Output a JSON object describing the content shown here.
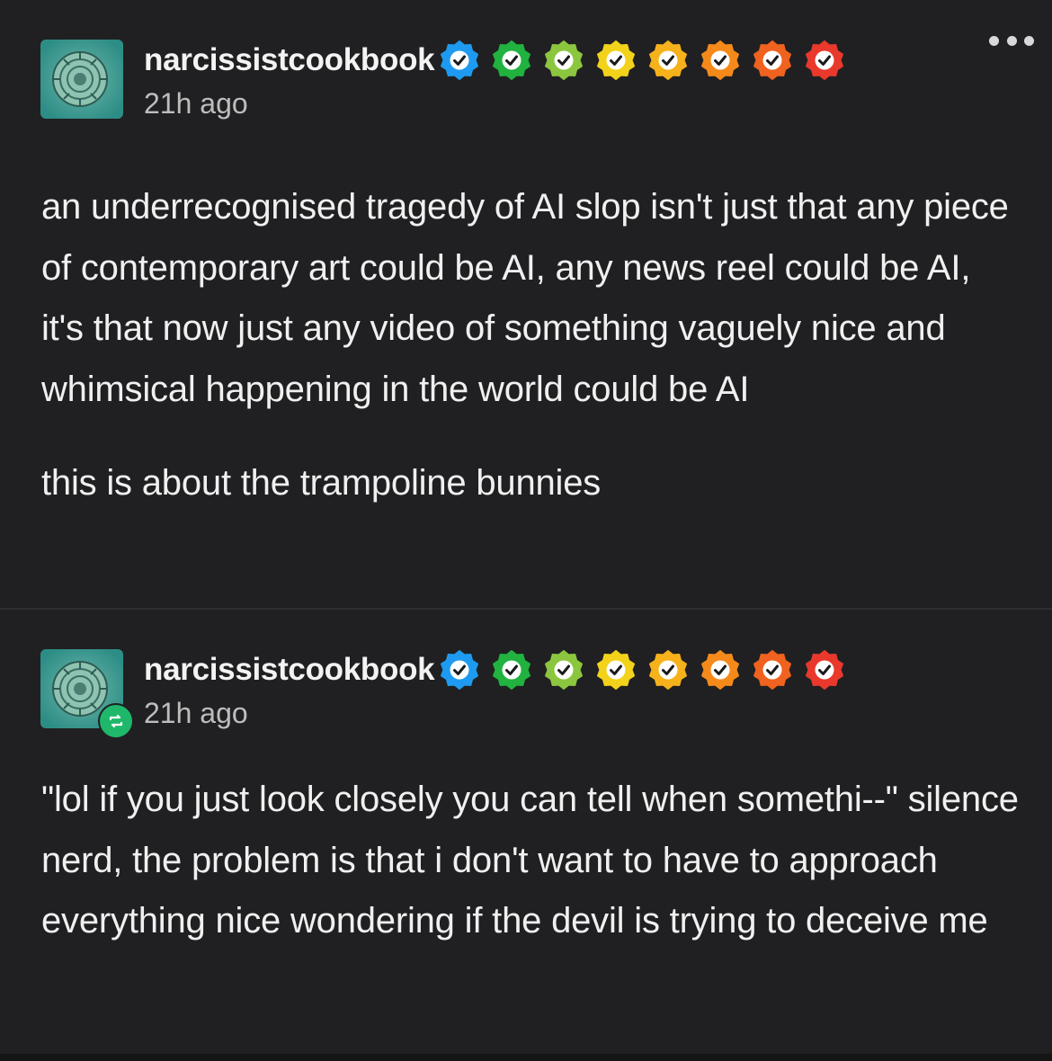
{
  "posts": [
    {
      "username": "narcissistcookbook",
      "timestamp": "21h ago",
      "avatar_icon": "ammonite-fossil-avatar",
      "is_reblog": false,
      "paragraphs": [
        "an underrecognised tragedy of AI slop isn't just that any piece of contemporary art could be AI, any news reel could be AI, it's that now just any video of something vaguely nice and whimsical happening in the world could be AI",
        "this is about the trampoline bunnies"
      ]
    },
    {
      "username": "narcissistcookbook",
      "timestamp": "21h ago",
      "avatar_icon": "ammonite-fossil-avatar",
      "is_reblog": true,
      "paragraphs": [
        "\"lol if you just look closely you can tell when somethi--\" silence nerd, the problem is that i don't want to have to approach everything nice wondering if the devil is trying to deceive me"
      ]
    }
  ],
  "badge_colors": [
    "#1e9bf0",
    "#21b23f",
    "#8cc63f",
    "#f2d21b",
    "#f5b21b",
    "#f58a1b",
    "#f0621f",
    "#e8392c"
  ],
  "colors": {
    "background": "#202022",
    "text": "#f0f0f0",
    "muted": "#bdbdbd",
    "reblog": "#1fb86a"
  },
  "icons": {
    "more": "more-options-icon",
    "badge": "verified-badge-icon",
    "reblog": "reblog-icon"
  }
}
